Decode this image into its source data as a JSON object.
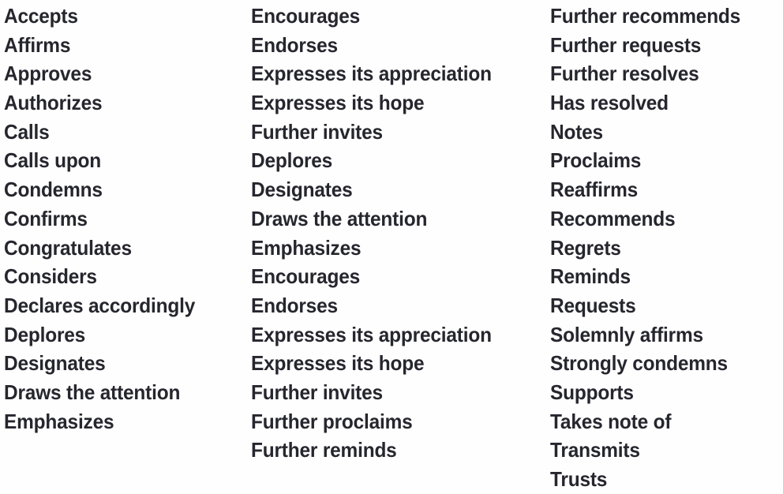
{
  "page": {
    "kind": "word-list",
    "background_color": "#fefefe",
    "text_color": "#26262e",
    "column_count": 3
  },
  "columns": [
    {
      "name": "column-1",
      "items": [
        "Accepts",
        "Affirms",
        "Approves",
        "Authorizes",
        "Calls",
        "Calls upon",
        "Condemns",
        "Confirms",
        "Congratulates",
        "Considers",
        "Declares accordingly",
        "Deplores",
        "Designates",
        "Draws the attention",
        "Emphasizes"
      ]
    },
    {
      "name": "column-2",
      "items": [
        "Encourages",
        "Endorses",
        "Expresses its appreciation",
        "Expresses its hope",
        "Further invites",
        "Deplores",
        "Designates",
        "Draws the attention",
        "Emphasizes",
        "Encourages",
        "Endorses",
        "Expresses its appreciation",
        "Expresses its hope",
        "Further invites",
        "Further proclaims",
        "Further reminds"
      ]
    },
    {
      "name": "column-3",
      "items": [
        "Further recommends",
        "Further requests",
        "Further resolves",
        "Has resolved",
        "Notes",
        "Proclaims",
        "Reaffirms",
        "Recommends",
        "Regrets",
        "Reminds",
        "Requests",
        "Solemnly affirms",
        "Strongly condemns",
        "Supports",
        "Takes note of",
        "Transmits",
        "Trusts"
      ]
    }
  ]
}
